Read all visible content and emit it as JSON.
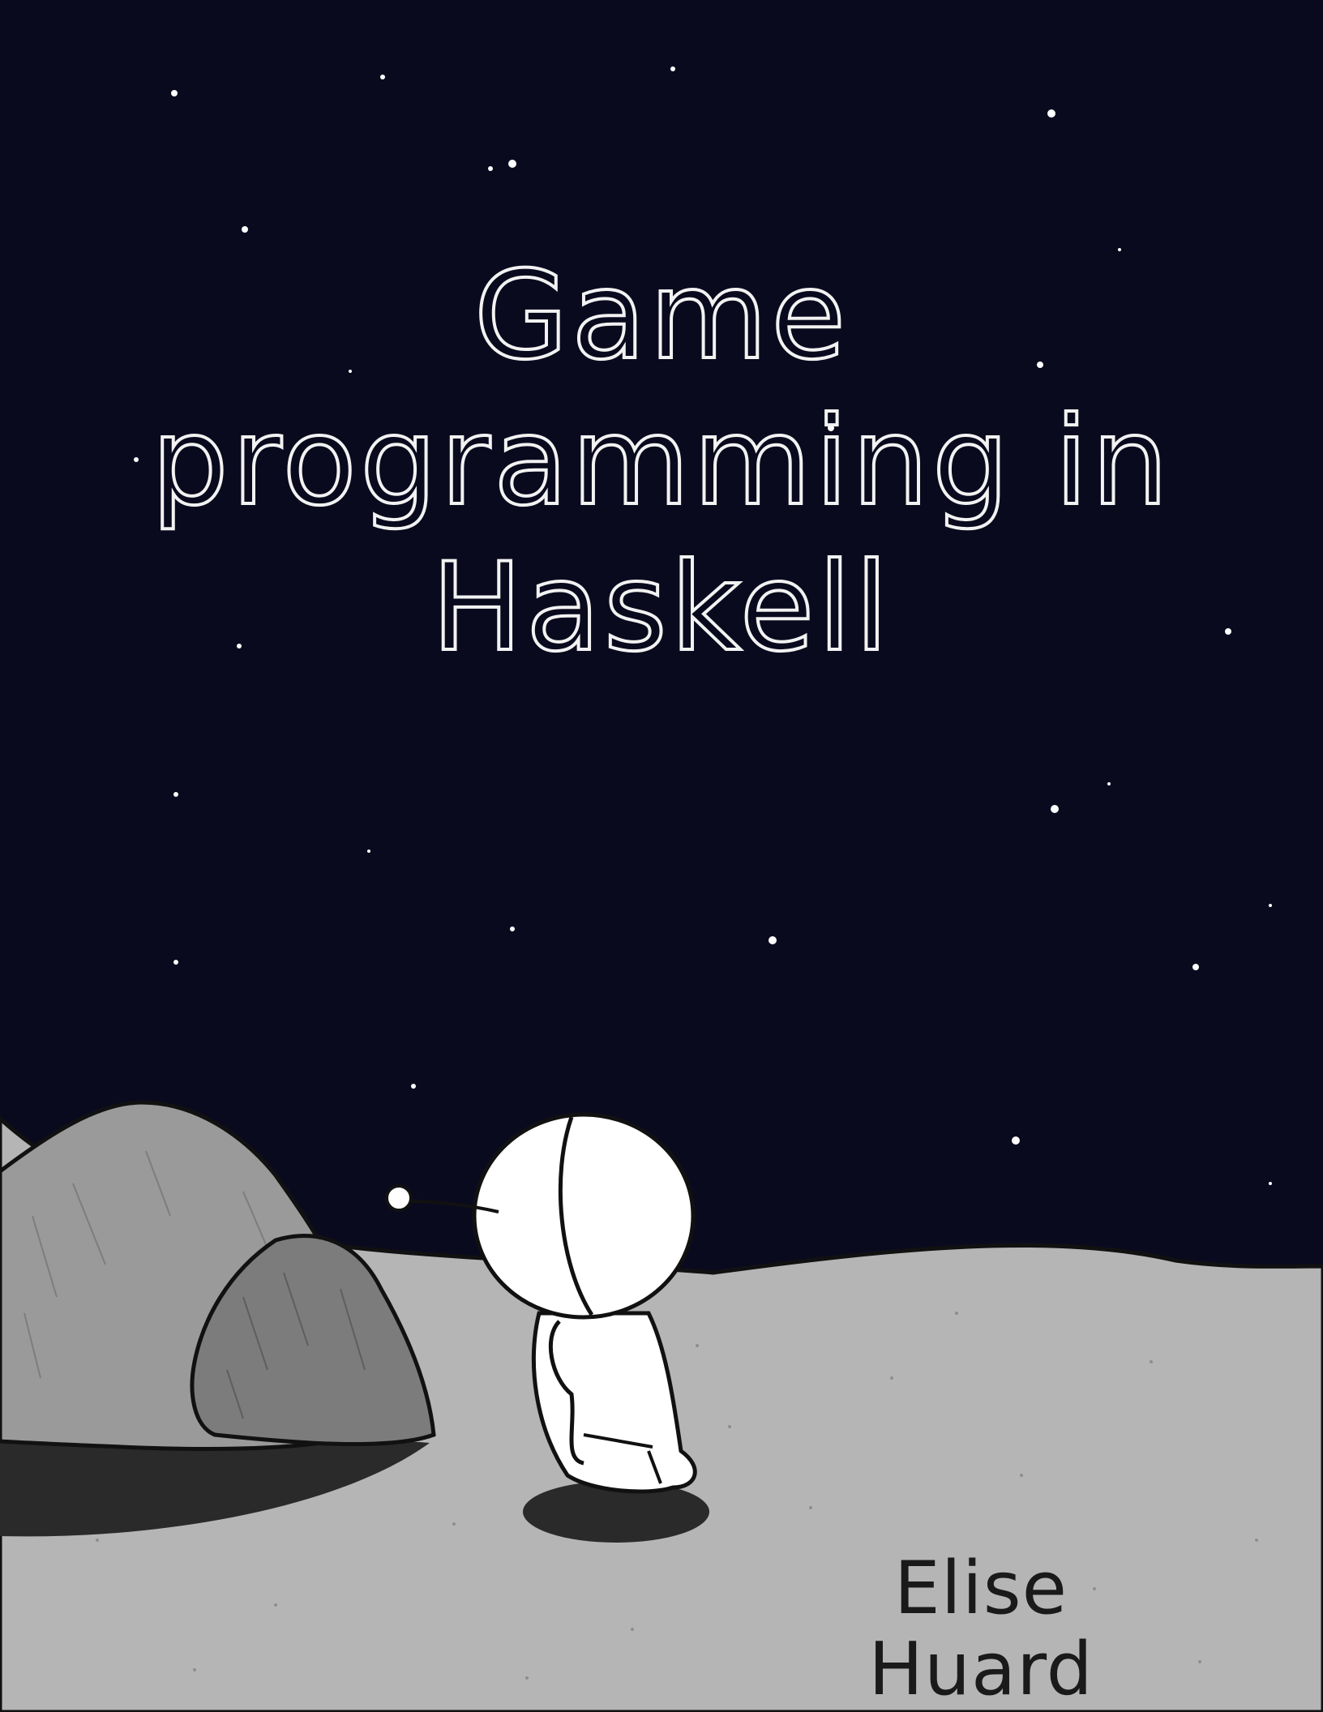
{
  "cover": {
    "title_lines": [
      "Game",
      "programming in",
      "Haskell"
    ],
    "author": "Elise Huard"
  },
  "colors": {
    "sky": "#0a0a1f",
    "ground": "#b5b5b5",
    "rock_light": "#9a9a9a",
    "rock_dark": "#7c7c7c",
    "character": "#ffffff",
    "outline": "#111111",
    "title_outline": "#f2f2f2"
  },
  "illustration": {
    "icons": [
      "star-icon",
      "rock-icon",
      "robot-character-icon"
    ]
  }
}
